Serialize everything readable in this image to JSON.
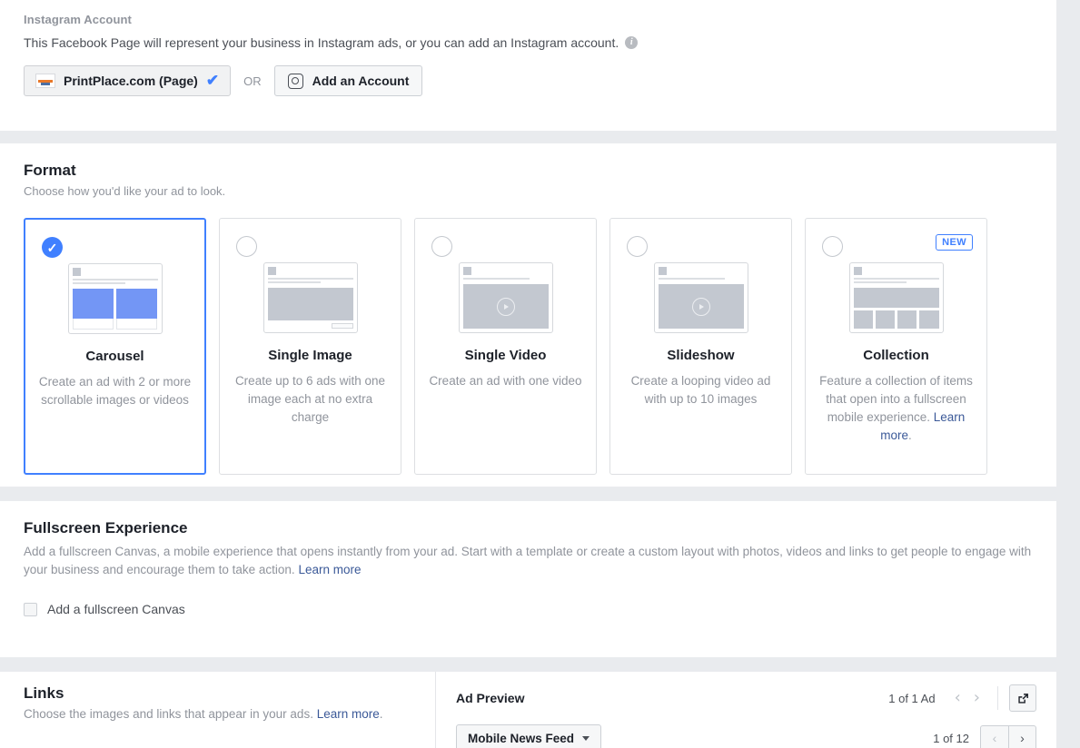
{
  "instagram": {
    "label": "Instagram Account",
    "description": "This Facebook Page will represent your business in Instagram ads, or you can add an Instagram account.",
    "info_icon": "info-icon",
    "page_button": {
      "name": "PrintPlace.com (Page)",
      "check": "✔"
    },
    "or_text": "OR",
    "add_account_button": "Add an Account"
  },
  "format": {
    "title": "Format",
    "subtitle": "Choose how you'd like your ad to look.",
    "cards": [
      {
        "id": "carousel",
        "title": "Carousel",
        "description": "Create an ad with 2 or more scrollable images or videos",
        "selected": true,
        "badge": null,
        "link": null
      },
      {
        "id": "single-image",
        "title": "Single Image",
        "description": "Create up to 6 ads with one image each at no extra charge",
        "selected": false,
        "badge": null,
        "link": null
      },
      {
        "id": "single-video",
        "title": "Single Video",
        "description": "Create an ad with one video",
        "selected": false,
        "badge": null,
        "link": null
      },
      {
        "id": "slideshow",
        "title": "Slideshow",
        "description": "Create a looping video ad with up to 10 images",
        "selected": false,
        "badge": null,
        "link": null
      },
      {
        "id": "collection",
        "title": "Collection",
        "description": "Feature a collection of items that open into a fullscreen mobile experience. ",
        "selected": false,
        "badge": "NEW",
        "link": "Learn more",
        "link_suffix": "."
      }
    ]
  },
  "fullscreen": {
    "title": "Fullscreen Experience",
    "description": "Add a fullscreen Canvas, a mobile experience that opens instantly from your ad. Start with a template or create a custom layout with photos, videos and links to get people to engage with your business and encourage them to take action. ",
    "learn_more": "Learn more",
    "checkbox_label": "Add a fullscreen Canvas",
    "checked": false
  },
  "links": {
    "title": "Links",
    "subtitle": "Choose the images and links that appear in your ads. ",
    "learn_more": "Learn more",
    "subtitle_suffix": "."
  },
  "preview": {
    "title": "Ad Preview",
    "count": "1 of 1 Ad",
    "prev_icon": "‹",
    "next_icon": "›",
    "popout_icon": "external-link-icon",
    "placement": "Mobile News Feed",
    "placement_count": "1 of 12",
    "placement_prev": "‹",
    "placement_next": "›"
  },
  "colors": {
    "accent": "#4080ff",
    "link": "#3b5998",
    "page_bg": "#e9ebee",
    "panel_bg": "#ffffff",
    "text_dark": "#1d2129",
    "text_muted": "#90949c"
  }
}
